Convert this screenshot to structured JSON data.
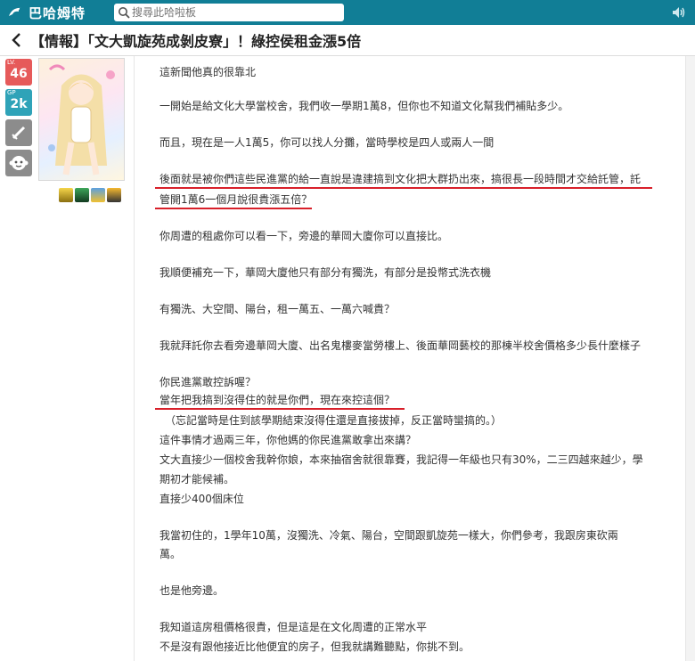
{
  "header": {
    "logo_text": "巴哈姆特",
    "search_placeholder": "搜尋此哈啦板"
  },
  "thread": {
    "title": "【情報】「文大凱旋苑成剝皮寮」！綠控侯租金漲5倍"
  },
  "user": {
    "lv_label": "LV.",
    "lv_value": "46",
    "gp_label": "GP",
    "gp_value": "2k",
    "icons": [
      "sword-icon",
      "monkey-face-icon"
    ]
  },
  "colors": {
    "topbar": "#117e96",
    "lv_badge": "#e65a5a",
    "gp_badge": "#2fa3b8",
    "underline": "#d8202a"
  },
  "post": {
    "lines": [
      "這新聞他真的很靠北",
      "一開始是給文化大學當校舍，我們收一學期1萬8，但你也不知道文化幫我們補貼多少。",
      "而且，現在是一人1萬5，你可以找人分攤，當時學校是四人或兩人一間",
      "後面就是被你們這些民進黨的給一直說是違建搞到文化把大群扔出來，搞很長一段時間才交給託管，託",
      "管開1萬6一個月說很貴漲五倍？",
      "你周遭的租處你可以看一下，旁邊的華岡大廈你可以直接比。",
      "我順便補充一下，華岡大廈他只有部分有獨洗，有部分是投幣式洗衣機",
      "有獨洗、大空間、陽台，租一萬五、一萬六喊貴？",
      "我就拜託你去看旁邊華岡大廈、出名鬼樓麥當勞樓上、後面華岡藝校的那棟半校舍價格多少長什麼樣子",
      "你民進黨敢控訴喔？",
      "當年把我搞到沒得住的就是你們，現在來控這個？",
      "（忘記當時是住到該學期結束沒得住還是直接拔掉，反正當時蠻搞的。）",
      "這件事情才過兩三年，你他媽的你民進黨敢拿出來講？",
      "文大直接少一個校舍我幹你娘，本來抽宿舍就很靠賽，我記得一年級也只有30%，二三四越來越少，學",
      "期初才能候補。",
      "直接少400個床位",
      "我當初住的，1學年10萬，沒獨洗、冷氣、陽台，空間跟凱旋苑一樣大，你們參考，我跟房東砍兩",
      "萬。",
      "也是他旁邊。",
      "我知道這房租價格很貴，但是這是在文化周遭的正常水平",
      "不是沒有跟他接近比他便宜的房子，但我就講難聽點，你挑不到。"
    ]
  }
}
